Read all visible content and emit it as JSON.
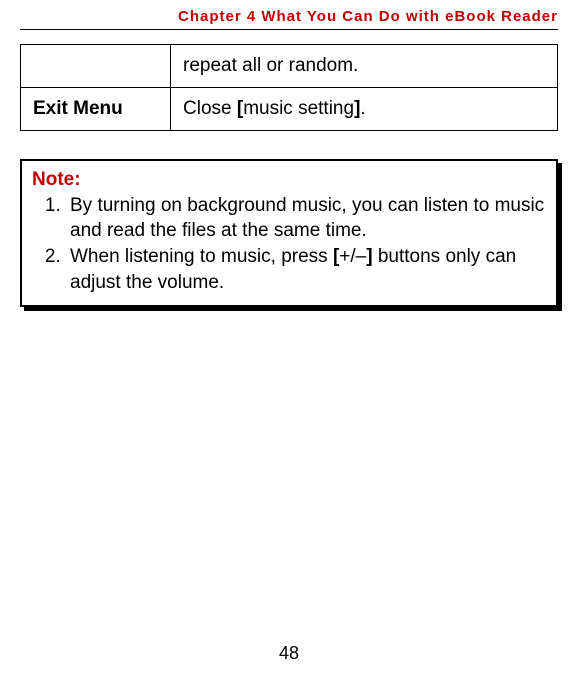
{
  "header": "Chapter 4 What You Can Do with eBook Reader",
  "table": {
    "row1": {
      "label": "",
      "desc": "repeat all or random."
    },
    "row2": {
      "label": "Exit Menu",
      "desc_prefix": "Close ",
      "desc_bracket_open": "[",
      "desc_mid": "music setting",
      "desc_bracket_close": "]",
      "desc_suffix": "."
    }
  },
  "note": {
    "title": "Note:",
    "item1": "By turning on background music, you can listen to music and read the files at the same time.",
    "item2_prefix": "When listening to music, press ",
    "item2_bracket_open": "[",
    "item2_mid": "+/–",
    "item2_bracket_close": "]",
    "item2_suffix": " buttons only can adjust the volume."
  },
  "page_number": "48"
}
